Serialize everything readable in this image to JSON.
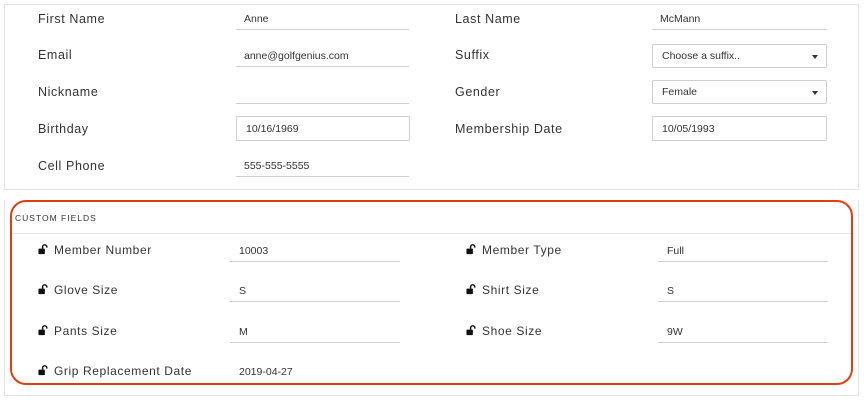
{
  "profile": {
    "first_name": {
      "label": "First Name",
      "value": "Anne"
    },
    "last_name": {
      "label": "Last Name",
      "value": "McMann"
    },
    "email": {
      "label": "Email",
      "value": "anne@golfgenius.com"
    },
    "suffix": {
      "label": "Suffix",
      "value": "Choose a suffix.."
    },
    "nickname": {
      "label": "Nickname",
      "value": ""
    },
    "gender": {
      "label": "Gender",
      "value": "Female"
    },
    "birthday": {
      "label": "Birthday",
      "value": "10/16/1969"
    },
    "membership_date": {
      "label": "Membership Date",
      "value": "10/05/1993"
    },
    "cell_phone": {
      "label": "Cell Phone",
      "value": "555-555-5555"
    }
  },
  "custom_fields": {
    "title": "CUSTOM FIELDS",
    "member_number": {
      "label": "Member Number",
      "value": "10003"
    },
    "member_type": {
      "label": "Member Type",
      "value": "Full"
    },
    "glove_size": {
      "label": "Glove Size",
      "value": "S"
    },
    "shirt_size": {
      "label": "Shirt Size",
      "value": "S"
    },
    "pants_size": {
      "label": "Pants Size",
      "value": "M"
    },
    "shoe_size": {
      "label": "Shoe Size",
      "value": "9W"
    },
    "grip_replacement_date": {
      "label": "Grip Replacement Date",
      "value": "2019-04-27"
    }
  },
  "colors": {
    "highlight": "#e03d12",
    "border": "#cfcfcf",
    "text": "#333333"
  },
  "icons": {
    "lock": "unlocked-padlock-icon",
    "dropdown": "caret-down-icon"
  }
}
